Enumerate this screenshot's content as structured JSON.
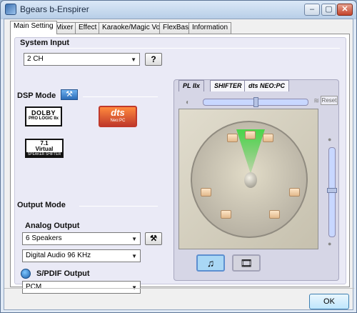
{
  "window": {
    "title": "Bgears b-Enspirer",
    "min_label": "–",
    "max_label": "▢",
    "close_label": "✕"
  },
  "tabs": [
    {
      "label": "Main Setting"
    },
    {
      "label": "Mixer"
    },
    {
      "label": "Effect"
    },
    {
      "label": "Karaoke/Magic Voice"
    },
    {
      "label": "FlexBass"
    },
    {
      "label": "Information"
    }
  ],
  "system_input": {
    "heading": "System Input",
    "selected": "2 CH",
    "help_label": "?"
  },
  "dsp_mode": {
    "heading": "DSP Mode",
    "dolby_line1": "DOLBY",
    "dolby_line2": "PRO LOGIC IIx",
    "dts_line1": "dts",
    "dts_line2": "Neo:PC",
    "virtual_line1": "7.1",
    "virtual_line2": "Virtual",
    "virtual_line3": "SPEAKER SHIFTER"
  },
  "output_mode": {
    "heading": "Output Mode",
    "analog_heading": "Analog Output",
    "speakers_selected": "6 Speakers",
    "audio_selected": "Digital Audio 96 KHz",
    "spdif_heading": "S/PDIF Output",
    "spdif_selected": "PCM"
  },
  "visualizer": {
    "tabs": [
      {
        "label": "PL IIx"
      },
      {
        "label": "SHIFTER"
      },
      {
        "label": "dts NEO:PC"
      }
    ],
    "reset_label": "Reset",
    "speakers": [
      "L",
      "C",
      "R",
      "SL",
      "SR",
      "BL",
      "BR"
    ]
  },
  "footer": {
    "ok_label": "OK"
  },
  "colors": {
    "title_bar": "#c9daee",
    "panel_bg": "#eaeaf6",
    "dts_orange": "#ff8a3d",
    "cone_green": "#4ad64a"
  }
}
